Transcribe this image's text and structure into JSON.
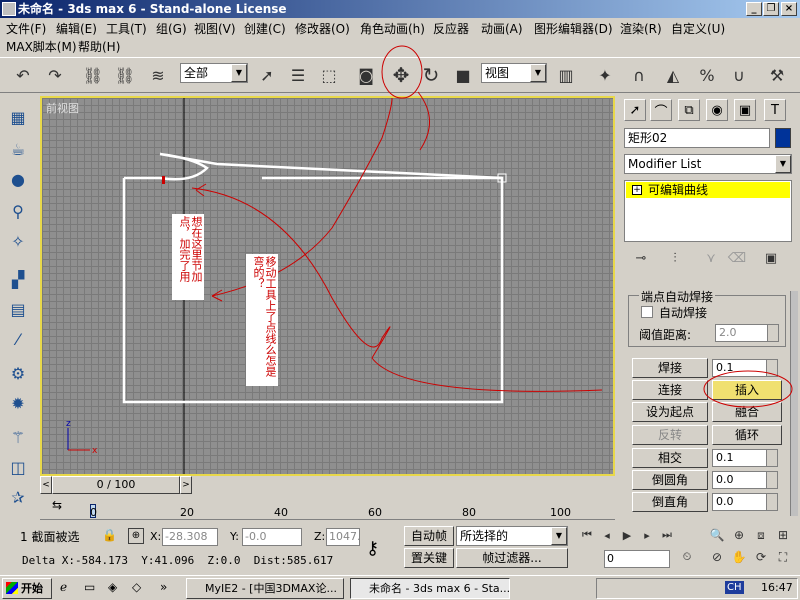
{
  "title": "未命名 - 3ds max 6 - Stand-alone License",
  "window_buttons": [
    "_",
    "❐",
    "×"
  ],
  "menu": [
    "文件(F)",
    "编辑(E)",
    "工具(T)",
    "组(G)",
    "视图(V)",
    "创建(C)",
    "修改器(O)",
    "角色动画(h)",
    "反应器",
    "动画(A)",
    "图形编辑器(D)",
    "渲染(R)",
    "自定义(U)",
    "MAX脚本(M)",
    "帮助(H)"
  ],
  "toolbar": {
    "selection_filter": "全部",
    "ref_coord": "视图"
  },
  "viewport": {
    "label": "前视图",
    "note1": "想在这里节加点，加完了用",
    "note2": "移动工具上了点线么怎是弯的？"
  },
  "right_panel": {
    "object_name": "矩形02",
    "modifier_list": "Modifier List",
    "stack_item": "可编辑曲线",
    "group_title": "端点自动焊接",
    "auto_weld": "自动焊接",
    "threshold_label": "阈值距离:",
    "threshold_value": "2.0",
    "buttons": [
      {
        "label": "焊接",
        "value": "0.1"
      },
      {
        "label": "连接",
        "right": "插入"
      },
      {
        "label": "设为起点",
        "right": "融合"
      },
      {
        "label": "反转",
        "right": "循环"
      },
      {
        "label": "相交",
        "value": "0.1"
      },
      {
        "label": "倒圆角",
        "value": "0.0"
      },
      {
        "label": "倒直角",
        "value": "0.0"
      }
    ]
  },
  "timeline": {
    "frame": "0 / 100",
    "ticks": [
      "0",
      "20",
      "40",
      "60",
      "80",
      "100"
    ]
  },
  "status": {
    "selected": "1 截面被选",
    "x_label": "X:",
    "x_val": "-28.308",
    "y_label": "Y:",
    "y_val": "-0.0",
    "z_label": "Z:",
    "z_val": "1047.",
    "delta": "Delta X:-584.173  Y:41.096  Z:0.0  Dist:585.617",
    "auto_key": "自动帧",
    "set_key": "置关键",
    "selected_set": "所选择的",
    "key_filter": "帧过滤器...",
    "frame_field": "0"
  },
  "taskbar": {
    "start": "开始",
    "items": [
      "MyIE2 - [中国3DMAX论...",
      "未命名 - 3ds max 6 - Sta..."
    ],
    "clock": "16:47",
    "lang": "CH"
  },
  "colors": {
    "title_start": "#0a246a",
    "title_end": "#a6caf0",
    "highlight": "#ffff00",
    "annotation": "#cc0000"
  }
}
